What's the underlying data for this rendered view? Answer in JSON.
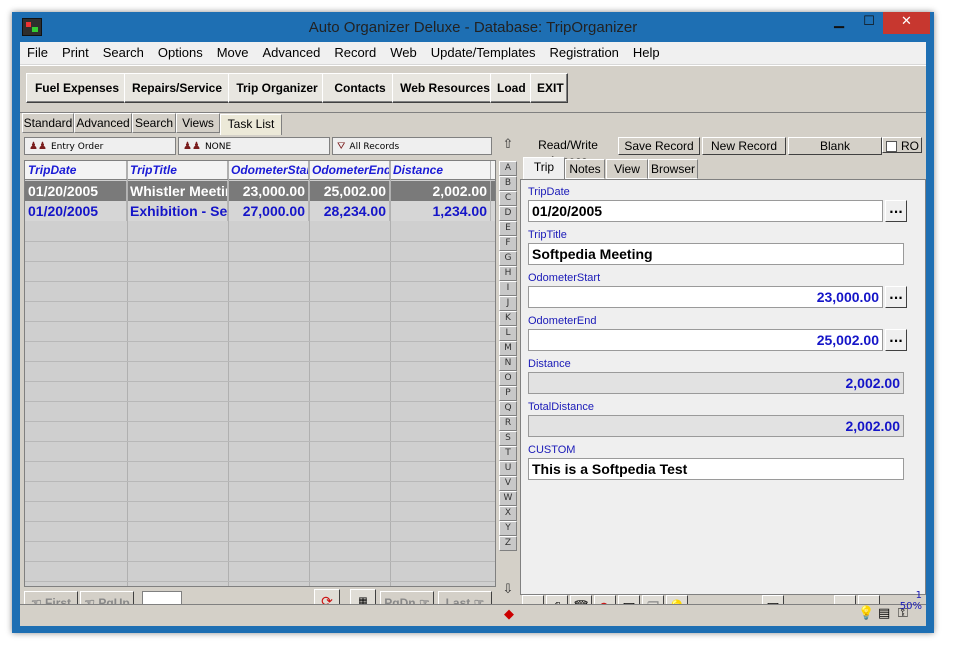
{
  "window": {
    "title": "Auto Organizer Deluxe - Database: TripOrganizer"
  },
  "menu": [
    "File",
    "Print",
    "Search",
    "Options",
    "Move",
    "Advanced",
    "Record",
    "Web",
    "Update/Templates",
    "Registration",
    "Help"
  ],
  "toolbar": {
    "fuel": "Fuel Expenses",
    "repairs": "Repairs/Service",
    "trip": "Trip Organizer",
    "contacts": "Contacts",
    "web": "Web Resources",
    "load": "Load",
    "exit": "EXIT"
  },
  "subtabs": [
    "Standard",
    "Advanced",
    "Search",
    "Views",
    "Task List"
  ],
  "sortbar": {
    "order": "Entry Order",
    "filter": "NONE",
    "records": "All Records"
  },
  "grid": {
    "columns": [
      "TripDate",
      "TripTitle",
      "OdometerStart",
      "OdometerEnd",
      "Distance"
    ],
    "rows": [
      [
        "01/20/2005",
        "Whistler Meeting",
        "23,000.00",
        "25,002.00",
        "2,002.00"
      ],
      [
        "01/20/2005",
        "Exhibition - Seattle",
        "27,000.00",
        "28,234.00",
        "1,234.00"
      ]
    ]
  },
  "nav": {
    "first": "First",
    "pgup": "PgUp",
    "pgdn": "PgDn",
    "last": "Last"
  },
  "alphabet": [
    "A",
    "B",
    "C",
    "D",
    "E",
    "F",
    "G",
    "H",
    "I",
    "J",
    "K",
    "L",
    "M",
    "N",
    "O",
    "P",
    "Q",
    "R",
    "S",
    "T",
    "U",
    "V",
    "W",
    "X",
    "Y",
    "Z"
  ],
  "record": {
    "access": "Read/Write Access",
    "save": "Save Record",
    "new": "New Record",
    "blank": "Blank",
    "ro": "RO"
  },
  "rtabs": [
    "Trip",
    "Notes",
    "View",
    "Browser"
  ],
  "form": {
    "tripdate_label": "TripDate",
    "tripdate": "01/20/2005",
    "triptitle_label": "TripTitle",
    "triptitle": "Softpedia Meeting",
    "odostart_label": "OdometerStart",
    "odostart": "23,000.00",
    "odoend_label": "OdometerEnd",
    "odoend": "25,002.00",
    "distance_label": "Distance",
    "distance": "2,002.00",
    "total_label": "TotalDistance",
    "total": "2,002.00",
    "custom_label": "CUSTOM",
    "custom": "This is a Softpedia Test",
    "ellipsis": "..."
  },
  "status": {
    "counter": "1",
    "percent": "50%"
  }
}
